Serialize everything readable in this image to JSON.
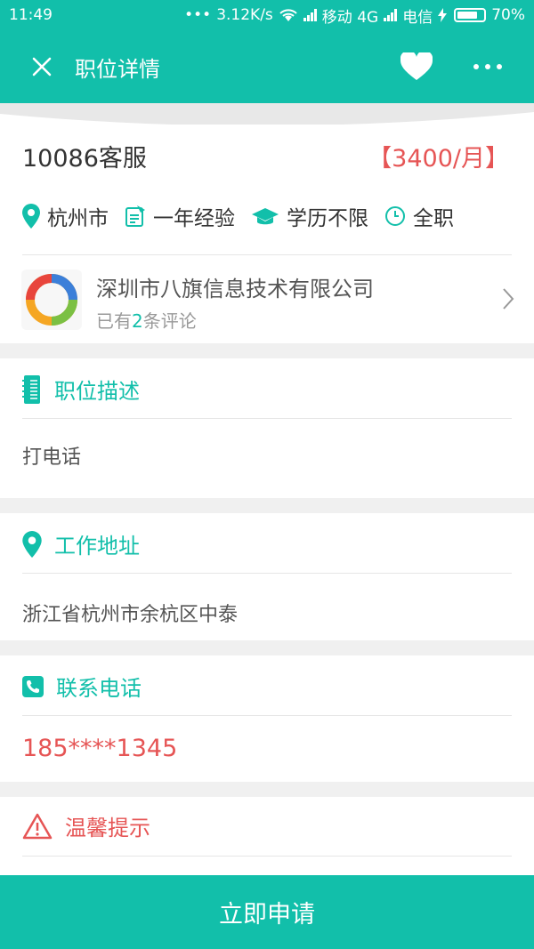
{
  "status_bar": {
    "time": "11:49",
    "dots": "•••",
    "speed": "3.12K/s",
    "carrier1": "移动 4G",
    "carrier2": "电信",
    "battery": "70%"
  },
  "app_bar": {
    "title": "职位详情"
  },
  "job": {
    "title": "10086客服",
    "salary": "【3400/月】",
    "tags": {
      "location": "杭州市",
      "experience": "一年经验",
      "education": "学历不限",
      "type": "全职"
    }
  },
  "company": {
    "name": "深圳市八旗信息技术有限公司",
    "reviews_prefix": "已有",
    "reviews_count": "2",
    "reviews_suffix": "条评论"
  },
  "sections": {
    "description": {
      "title": "职位描述",
      "content": "打电话"
    },
    "address": {
      "title": "工作地址",
      "content": "浙江省杭州市余杭区中泰"
    },
    "contact": {
      "title": "联系电话",
      "content": "185****1345"
    },
    "tips": {
      "title": "温馨提示"
    }
  },
  "apply_button": {
    "label": "立即申请"
  },
  "colors": {
    "brand": "#12bfaa",
    "accent_red": "#e65555"
  }
}
